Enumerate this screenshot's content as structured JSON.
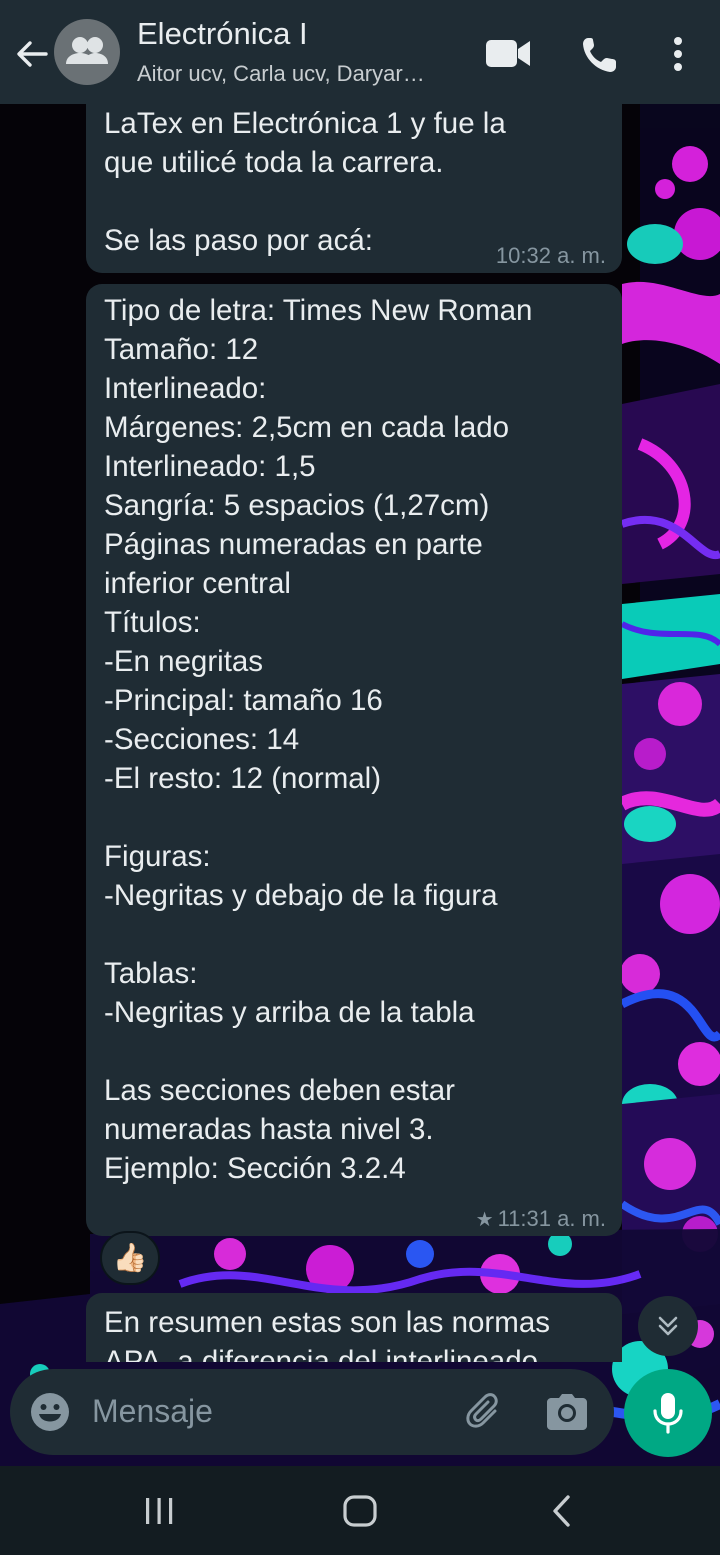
{
  "header": {
    "title": "Electrónica I",
    "subtitle": "Aitor ucv, Carla ucv, Daryar…",
    "icons": [
      "back-arrow-icon",
      "group-avatar-icon",
      "video-call-icon",
      "phone-call-icon",
      "more-options-icon"
    ]
  },
  "messages": [
    {
      "lines": [
        "LaTex en Electrónica 1 y fue la",
        "que utilicé toda la carrera.",
        "",
        "Se las paso por acá:"
      ],
      "time": "10:32 a. m.",
      "starred": false
    },
    {
      "lines": [
        "Tipo de letra: Times New Roman",
        "Tamaño: 12",
        "Interlineado:",
        "Márgenes: 2,5cm en cada lado",
        "Interlineado: 1,5",
        "Sangría: 5 espacios (1,27cm)",
        "Páginas numeradas en parte",
        "inferior central",
        "Títulos:",
        "-En negritas",
        "-Principal: tamaño 16",
        "-Secciones: 14",
        "-El resto: 12 (normal)",
        "",
        "Figuras:",
        "-Negritas y debajo de la figura",
        "",
        "Tablas:",
        "-Negritas y arriba de la tabla",
        "",
        "Las secciones deben estar",
        "numeradas hasta nivel 3.",
        "Ejemplo: Sección 3.2.4"
      ],
      "time": "11:31 a. m.",
      "starred": true,
      "star_glyph": "★",
      "reaction": "👍🏻"
    },
    {
      "lines": [
        "En resumen estas son las normas",
        "APA, a diferencia del interlineado"
      ],
      "partially_visible": true
    }
  ],
  "composer": {
    "placeholder": "Mensaje",
    "icons": [
      "emoji-icon",
      "attach-icon",
      "camera-icon",
      "mic-icon"
    ]
  },
  "colors": {
    "header_bg": "#1f2c34",
    "bubble_bg": "#1f2c34",
    "accent_green": "#00a884",
    "meta_text": "#8696a0",
    "navbar_bg": "#131c21"
  }
}
